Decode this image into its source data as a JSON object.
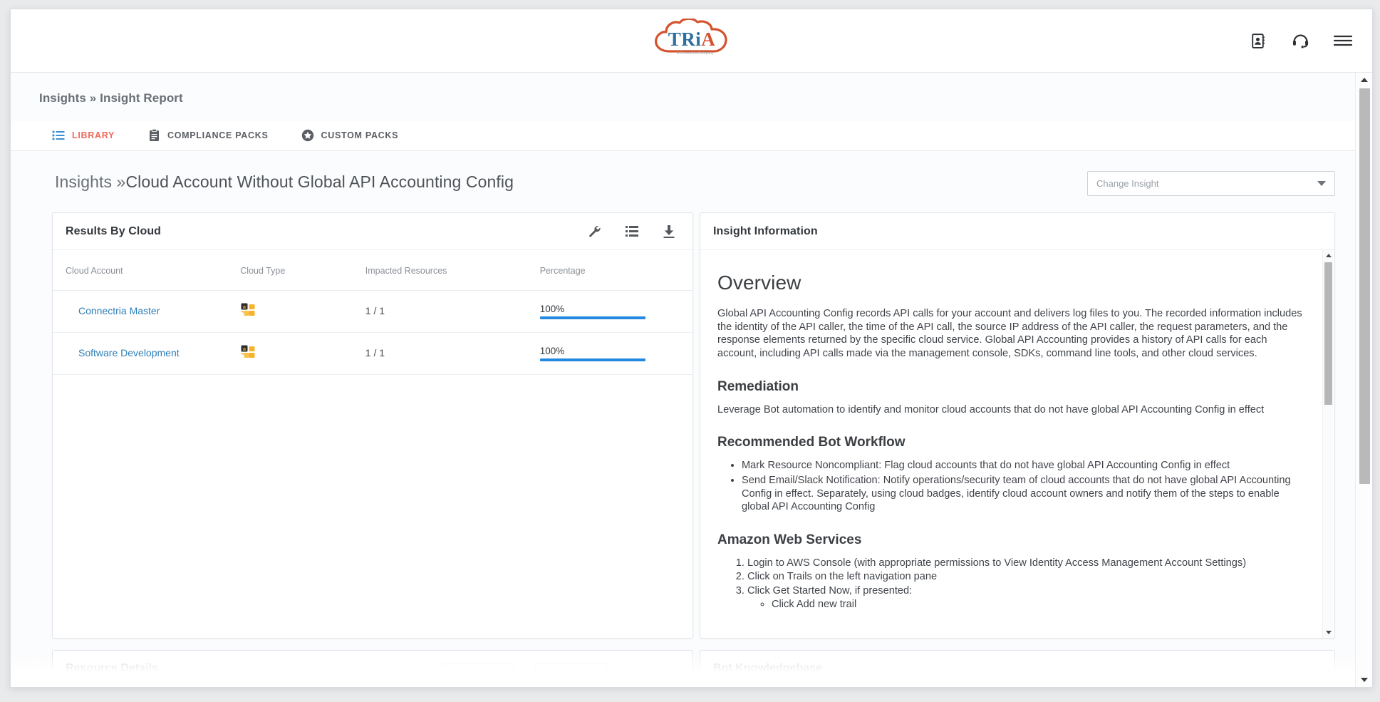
{
  "app": {
    "logo_text": "TRiA",
    "logo_color": "#d4532f",
    "logo_text_color": "#2e6f9e"
  },
  "topbar": {
    "icons": [
      {
        "name": "address-book-icon",
        "label": "Contacts"
      },
      {
        "name": "headset-support-icon",
        "label": "Support"
      },
      {
        "name": "hamburger-menu-icon",
        "label": "Menu"
      }
    ]
  },
  "breadcrumb": {
    "text": "Insights » Insight Report"
  },
  "tabs": [
    {
      "label": "LIBRARY",
      "icon": "list-icon",
      "active": true
    },
    {
      "label": "COMPLIANCE PACKS",
      "icon": "clipboard-icon",
      "active": false
    },
    {
      "label": "CUSTOM PACKS",
      "icon": "star-badge-icon",
      "active": false
    }
  ],
  "page": {
    "title_crumb": "Insights »",
    "title_main": "Cloud Account Without Global API Accounting Config"
  },
  "change_insight": {
    "placeholder": "Change Insight",
    "value": "Change Insight"
  },
  "results_panel": {
    "title": "Results By Cloud",
    "icons": [
      {
        "name": "wrench-icon",
        "label": "Settings"
      },
      {
        "name": "list-view-icon",
        "label": "List View"
      },
      {
        "name": "download-icon",
        "label": "Download"
      }
    ],
    "columns": [
      "Cloud Account",
      "Cloud Type",
      "Impacted Resources",
      "Percentage"
    ],
    "rows": [
      {
        "account": "Connectria Master",
        "cloud_type": "aws-icon",
        "impacted": "1 / 1",
        "percentage_label": "100%",
        "percentage_value": 100
      },
      {
        "account": "Software Development",
        "cloud_type": "aws-icon",
        "impacted": "1 / 1",
        "percentage_label": "100%",
        "percentage_value": 100
      }
    ],
    "bar_color": "#2288e0",
    "link_color": "#2f7fb5"
  },
  "insight_panel": {
    "title": "Insight Information",
    "overview_heading": "Overview",
    "overview_text": "Global API Accounting Config records API calls for your account and delivers log files to you. The recorded information includes the identity of the API caller, the time of the API call, the source IP address of the API caller, the request parameters, and the response elements returned by the specific cloud service. Global API Accounting provides a history of API calls for each account, including API calls made via the management console, SDKs, command line tools, and other cloud services.",
    "remediation_heading": "Remediation",
    "remediation_text": "Leverage Bot automation to identify and monitor cloud accounts that do not have global API Accounting Config in effect",
    "workflow_heading": "Recommended Bot Workflow",
    "workflow_items": [
      "Mark Resource Noncompliant: Flag cloud accounts that do not have global API Accounting Config in effect",
      "Send Email/Slack Notification: Notify operations/security team of cloud accounts that do not have global API Accounting Config in effect. Separately, using cloud badges, identify cloud account owners and notify them of the steps to enable global API Accounting Config"
    ],
    "aws_heading": "Amazon Web Services",
    "aws_steps": [
      "Login to AWS Console (with appropriate permissions to View Identity Access Management Account Settings)",
      "Click on Trails on the left navigation pane",
      "Click Get Started Now, if presented:"
    ],
    "aws_substep": "Click Add new trail"
  },
  "lower_panels": {
    "left_title": "Resource Details",
    "right_title": "Bot Knowledgebase"
  }
}
